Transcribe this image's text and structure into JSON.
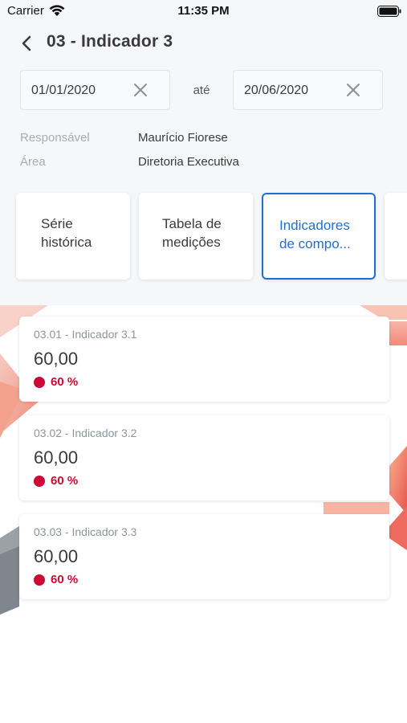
{
  "status_bar": {
    "carrier": "Carrier",
    "time": "11:35 PM"
  },
  "header": {
    "title": "03 - Indicador 3"
  },
  "date_range": {
    "start": "01/01/2020",
    "separator": "até",
    "end": "20/06/2020"
  },
  "info": [
    {
      "label": "Responsável",
      "value": "Maurício Fiorese"
    },
    {
      "label": "Área",
      "value": "Diretoria Executiva"
    }
  ],
  "tabs": [
    {
      "label": "Série\nhistórica",
      "selected": false
    },
    {
      "label": "Tabela de\nmedições",
      "selected": false
    },
    {
      "label": "Indicadores\nde compo...",
      "selected": true
    },
    {
      "label": "",
      "selected": false
    }
  ],
  "indicators": [
    {
      "name": "03.01 - Indicador 3.1",
      "value": "60,00",
      "percent": "60 %",
      "status_color": "#cc0a35"
    },
    {
      "name": "03.02 - Indicador 3.2",
      "value": "60,00",
      "percent": "60 %",
      "status_color": "#cc0a35"
    },
    {
      "name": "03.03 - Indicador 3.3",
      "value": "60,00",
      "percent": "60 %",
      "status_color": "#cc0a35"
    }
  ],
  "colors": {
    "accent": "#1f6fd1",
    "status_red": "#cc0a35"
  }
}
